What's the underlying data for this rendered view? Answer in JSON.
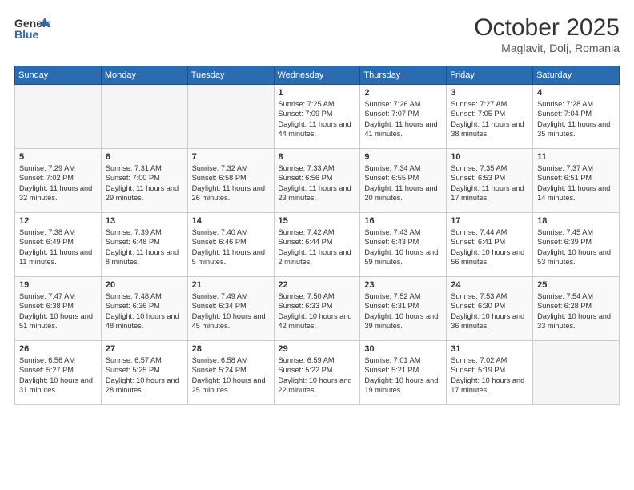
{
  "header": {
    "logo_line1": "General",
    "logo_line2": "Blue",
    "month": "October 2025",
    "location": "Maglavit, Dolj, Romania"
  },
  "days_of_week": [
    "Sunday",
    "Monday",
    "Tuesday",
    "Wednesday",
    "Thursday",
    "Friday",
    "Saturday"
  ],
  "weeks": [
    [
      {
        "day": "",
        "empty": true
      },
      {
        "day": "",
        "empty": true
      },
      {
        "day": "",
        "empty": true
      },
      {
        "day": "1",
        "sunrise": "7:25 AM",
        "sunset": "7:09 PM",
        "daylight": "11 hours and 44 minutes."
      },
      {
        "day": "2",
        "sunrise": "7:26 AM",
        "sunset": "7:07 PM",
        "daylight": "11 hours and 41 minutes."
      },
      {
        "day": "3",
        "sunrise": "7:27 AM",
        "sunset": "7:05 PM",
        "daylight": "11 hours and 38 minutes."
      },
      {
        "day": "4",
        "sunrise": "7:28 AM",
        "sunset": "7:04 PM",
        "daylight": "11 hours and 35 minutes."
      }
    ],
    [
      {
        "day": "5",
        "sunrise": "7:29 AM",
        "sunset": "7:02 PM",
        "daylight": "11 hours and 32 minutes."
      },
      {
        "day": "6",
        "sunrise": "7:31 AM",
        "sunset": "7:00 PM",
        "daylight": "11 hours and 29 minutes."
      },
      {
        "day": "7",
        "sunrise": "7:32 AM",
        "sunset": "6:58 PM",
        "daylight": "11 hours and 26 minutes."
      },
      {
        "day": "8",
        "sunrise": "7:33 AM",
        "sunset": "6:56 PM",
        "daylight": "11 hours and 23 minutes."
      },
      {
        "day": "9",
        "sunrise": "7:34 AM",
        "sunset": "6:55 PM",
        "daylight": "11 hours and 20 minutes."
      },
      {
        "day": "10",
        "sunrise": "7:35 AM",
        "sunset": "6:53 PM",
        "daylight": "11 hours and 17 minutes."
      },
      {
        "day": "11",
        "sunrise": "7:37 AM",
        "sunset": "6:51 PM",
        "daylight": "11 hours and 14 minutes."
      }
    ],
    [
      {
        "day": "12",
        "sunrise": "7:38 AM",
        "sunset": "6:49 PM",
        "daylight": "11 hours and 11 minutes."
      },
      {
        "day": "13",
        "sunrise": "7:39 AM",
        "sunset": "6:48 PM",
        "daylight": "11 hours and 8 minutes."
      },
      {
        "day": "14",
        "sunrise": "7:40 AM",
        "sunset": "6:46 PM",
        "daylight": "11 hours and 5 minutes."
      },
      {
        "day": "15",
        "sunrise": "7:42 AM",
        "sunset": "6:44 PM",
        "daylight": "11 hours and 2 minutes."
      },
      {
        "day": "16",
        "sunrise": "7:43 AM",
        "sunset": "6:43 PM",
        "daylight": "10 hours and 59 minutes."
      },
      {
        "day": "17",
        "sunrise": "7:44 AM",
        "sunset": "6:41 PM",
        "daylight": "10 hours and 56 minutes."
      },
      {
        "day": "18",
        "sunrise": "7:45 AM",
        "sunset": "6:39 PM",
        "daylight": "10 hours and 53 minutes."
      }
    ],
    [
      {
        "day": "19",
        "sunrise": "7:47 AM",
        "sunset": "6:38 PM",
        "daylight": "10 hours and 51 minutes."
      },
      {
        "day": "20",
        "sunrise": "7:48 AM",
        "sunset": "6:36 PM",
        "daylight": "10 hours and 48 minutes."
      },
      {
        "day": "21",
        "sunrise": "7:49 AM",
        "sunset": "6:34 PM",
        "daylight": "10 hours and 45 minutes."
      },
      {
        "day": "22",
        "sunrise": "7:50 AM",
        "sunset": "6:33 PM",
        "daylight": "10 hours and 42 minutes."
      },
      {
        "day": "23",
        "sunrise": "7:52 AM",
        "sunset": "6:31 PM",
        "daylight": "10 hours and 39 minutes."
      },
      {
        "day": "24",
        "sunrise": "7:53 AM",
        "sunset": "6:30 PM",
        "daylight": "10 hours and 36 minutes."
      },
      {
        "day": "25",
        "sunrise": "7:54 AM",
        "sunset": "6:28 PM",
        "daylight": "10 hours and 33 minutes."
      }
    ],
    [
      {
        "day": "26",
        "sunrise": "6:56 AM",
        "sunset": "5:27 PM",
        "daylight": "10 hours and 31 minutes."
      },
      {
        "day": "27",
        "sunrise": "6:57 AM",
        "sunset": "5:25 PM",
        "daylight": "10 hours and 28 minutes."
      },
      {
        "day": "28",
        "sunrise": "6:58 AM",
        "sunset": "5:24 PM",
        "daylight": "10 hours and 25 minutes."
      },
      {
        "day": "29",
        "sunrise": "6:59 AM",
        "sunset": "5:22 PM",
        "daylight": "10 hours and 22 minutes."
      },
      {
        "day": "30",
        "sunrise": "7:01 AM",
        "sunset": "5:21 PM",
        "daylight": "10 hours and 19 minutes."
      },
      {
        "day": "31",
        "sunrise": "7:02 AM",
        "sunset": "5:19 PM",
        "daylight": "10 hours and 17 minutes."
      },
      {
        "day": "",
        "empty": true
      }
    ]
  ]
}
